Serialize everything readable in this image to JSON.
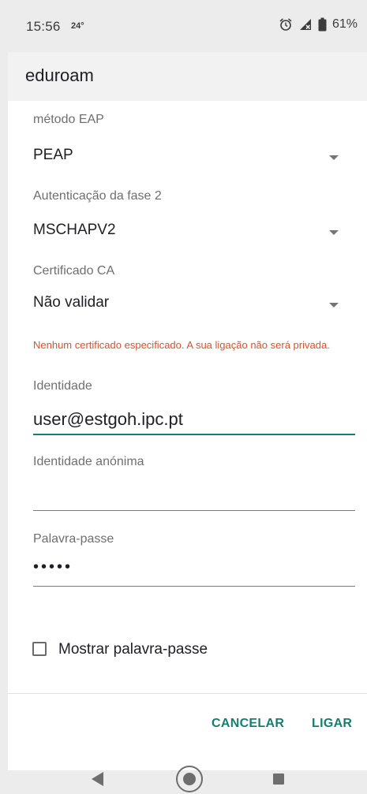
{
  "status_bar": {
    "time": "15:56",
    "temperature": "24°",
    "battery": "61%",
    "icons": [
      "alarm-icon",
      "signal-icon",
      "battery-icon"
    ]
  },
  "dialog": {
    "title": "eduroam",
    "eap_method": {
      "label": "método EAP",
      "value": "PEAP"
    },
    "phase2_auth": {
      "label": "Autenticação da fase 2",
      "value": "MSCHAPV2"
    },
    "ca_certificate": {
      "label": "Certificado CA",
      "value": "Não validar",
      "warning": "Nenhum certificado especificado. A sua ligação não será privada."
    },
    "identity": {
      "label": "Identidade",
      "value": "user@estgoh.ipc.pt"
    },
    "anonymous_identity": {
      "label": "Identidade anónima",
      "value": ""
    },
    "password": {
      "label": "Palavra-passe",
      "value": "•••••"
    },
    "show_password": {
      "label": "Mostrar palavra-passe",
      "checked": false
    },
    "actions": {
      "cancel": "CANCELAR",
      "connect": "LIGAR"
    }
  },
  "colors": {
    "accent": "#167d70",
    "warning": "#d8512a",
    "background": "#ececec"
  },
  "nav_bar": {
    "icons": [
      "back-icon",
      "home-icon",
      "recents-icon"
    ]
  }
}
